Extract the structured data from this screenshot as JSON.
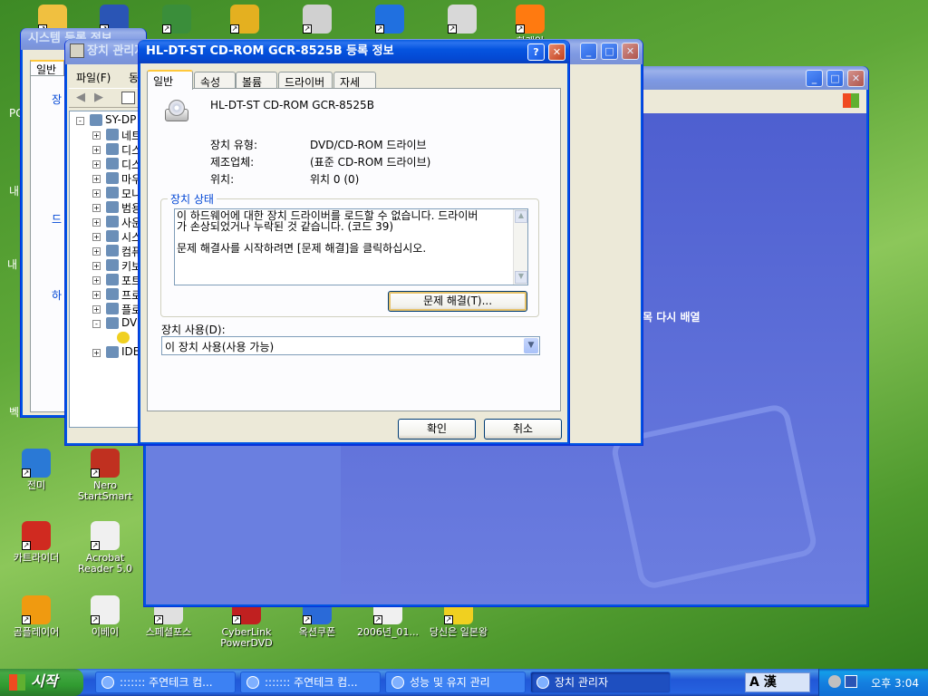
{
  "desktop_icons": [
    {
      "label": "",
      "color": "#f0c040"
    },
    {
      "label": "",
      "color": "#2a55b5"
    },
    {
      "label": "",
      "color": "#3a8e3a"
    },
    {
      "label": "",
      "color": "#e4b020"
    },
    {
      "label": "",
      "color": "#d0d0d0"
    },
    {
      "label": "",
      "color": "#2070e0"
    },
    {
      "label": "",
      "color": "#d8d8d8"
    },
    {
      "label": "하게임",
      "color": "#ff7a10"
    },
    {
      "label": "전미",
      "color": "#2a79d6"
    },
    {
      "label": "Nero StartSmart",
      "color": "#c03020"
    },
    {
      "label": "카트라이더",
      "color": "#d02a20"
    },
    {
      "label": "Acrobat Reader 5.0",
      "color": "#f0f0f0"
    },
    {
      "label": "곰플레이어",
      "color": "#f09a10"
    },
    {
      "label": "이베이",
      "color": "#f0f0f0"
    },
    {
      "label": "스페셜포스",
      "color": "#e0e0e0"
    },
    {
      "label": "CyberLink PowerDVD",
      "color": "#c02020"
    },
    {
      "label": "옥션쿠폰",
      "color": "#2a6ad8"
    },
    {
      "label": "2006년_01...",
      "color": "#f0f0f0"
    },
    {
      "label": "당신은 일본왕",
      "color": "#f0d020"
    }
  ],
  "left_edge_labels": [
    "PC",
    "내",
    "내",
    "벡"
  ],
  "sysprops": {
    "title": "시스템 등록 정보",
    "tab": "일반",
    "frag1": "장",
    "frag2": "드",
    "frag3": "하"
  },
  "devmgr": {
    "title": "장치 관리자",
    "menu_file": "파일(F)",
    "menu_action": "동",
    "tree": [
      {
        "label": "SY-DP",
        "pm": "-"
      },
      {
        "label": "네트",
        "pm": "+"
      },
      {
        "label": "디스",
        "pm": "+"
      },
      {
        "label": "디스",
        "pm": "+"
      },
      {
        "label": "마우",
        "pm": "+"
      },
      {
        "label": "모니",
        "pm": "+"
      },
      {
        "label": "범용",
        "pm": "+"
      },
      {
        "label": "사운",
        "pm": "+"
      },
      {
        "label": "시스",
        "pm": "+"
      },
      {
        "label": "컴퓨",
        "pm": "+"
      },
      {
        "label": "키보",
        "pm": "+"
      },
      {
        "label": "포트",
        "pm": "+"
      },
      {
        "label": "프로",
        "pm": "+"
      },
      {
        "label": "플로",
        "pm": "+"
      },
      {
        "label": "DVD",
        "pm": "-"
      },
      {
        "label": "",
        "pm": ""
      },
      {
        "label": "IDE",
        "pm": "+"
      }
    ]
  },
  "perf_window": {
    "text": "목 다시 배열"
  },
  "dialog": {
    "title": "HL-DT-ST CD-ROM GCR-8525B 등록 정보",
    "tabs": [
      "일반",
      "속성",
      "볼륨",
      "드라이버",
      "자세히"
    ],
    "device_name": "HL-DT-ST CD-ROM GCR-8525B",
    "type_label": "장치 유형:",
    "type_value": "DVD/CD-ROM 드라이브",
    "mfr_label": "제조업체:",
    "mfr_value": "(표준 CD-ROM 드라이브)",
    "loc_label": "위치:",
    "loc_value": "위치 0 (0)",
    "status_group": "장치 상태",
    "status_line1": "이 하드웨어에 대한 장치 드라이버를 로드할 수 없습니다. 드라이버",
    "status_line2": "가 손상되었거나 누락된 것 같습니다. (코드 39)",
    "status_line3": "문제 해결사를 시작하려면 [문제 해결]을 클릭하십시오.",
    "troubleshoot": "문제 해결(T)...",
    "usage_label": "장치 사용(D):",
    "usage_value": "이 장치 사용(사용 가능)",
    "ok": "확인",
    "cancel": "취소",
    "help_btn": "?",
    "close_btn": "✕"
  },
  "taskbar": {
    "start": "시작",
    "tasks": [
      "::::::: 주연테크 컴...",
      "::::::: 주연테크 컴...",
      "성능 및 유지 관리",
      "장치 관리자"
    ],
    "lang": "A 漢",
    "time": "오후 3:04"
  }
}
